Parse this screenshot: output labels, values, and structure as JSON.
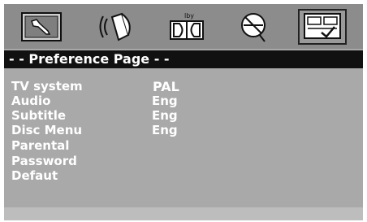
{
  "title": "- - Preference Page - -",
  "tabs": [
    {
      "name": "general-setup",
      "icon": "wrench-icon",
      "active": false
    },
    {
      "name": "audio-setup",
      "icon": "speaker-icon",
      "active": false
    },
    {
      "name": "dolby-setup",
      "icon": "dolby-icon",
      "caption": "lby",
      "active": false
    },
    {
      "name": "video-setup",
      "icon": "globe-icon",
      "active": false
    },
    {
      "name": "preference-setup",
      "icon": "preference-icon",
      "active": true
    }
  ],
  "menu": [
    {
      "label": "TV system",
      "value": "PAL"
    },
    {
      "label": "Audio",
      "value": "Eng"
    },
    {
      "label": "Subtitle",
      "value": "Eng"
    },
    {
      "label": "Disc Menu",
      "value": "Eng"
    },
    {
      "label": "Parental",
      "value": ""
    },
    {
      "label": "Password",
      "value": ""
    },
    {
      "label": "Defaut",
      "value": ""
    }
  ],
  "colors": {
    "screen": "#a9a9a9",
    "iconbar": "#8c8c8c",
    "titlebar": "#111111",
    "text": "#ffffff"
  }
}
